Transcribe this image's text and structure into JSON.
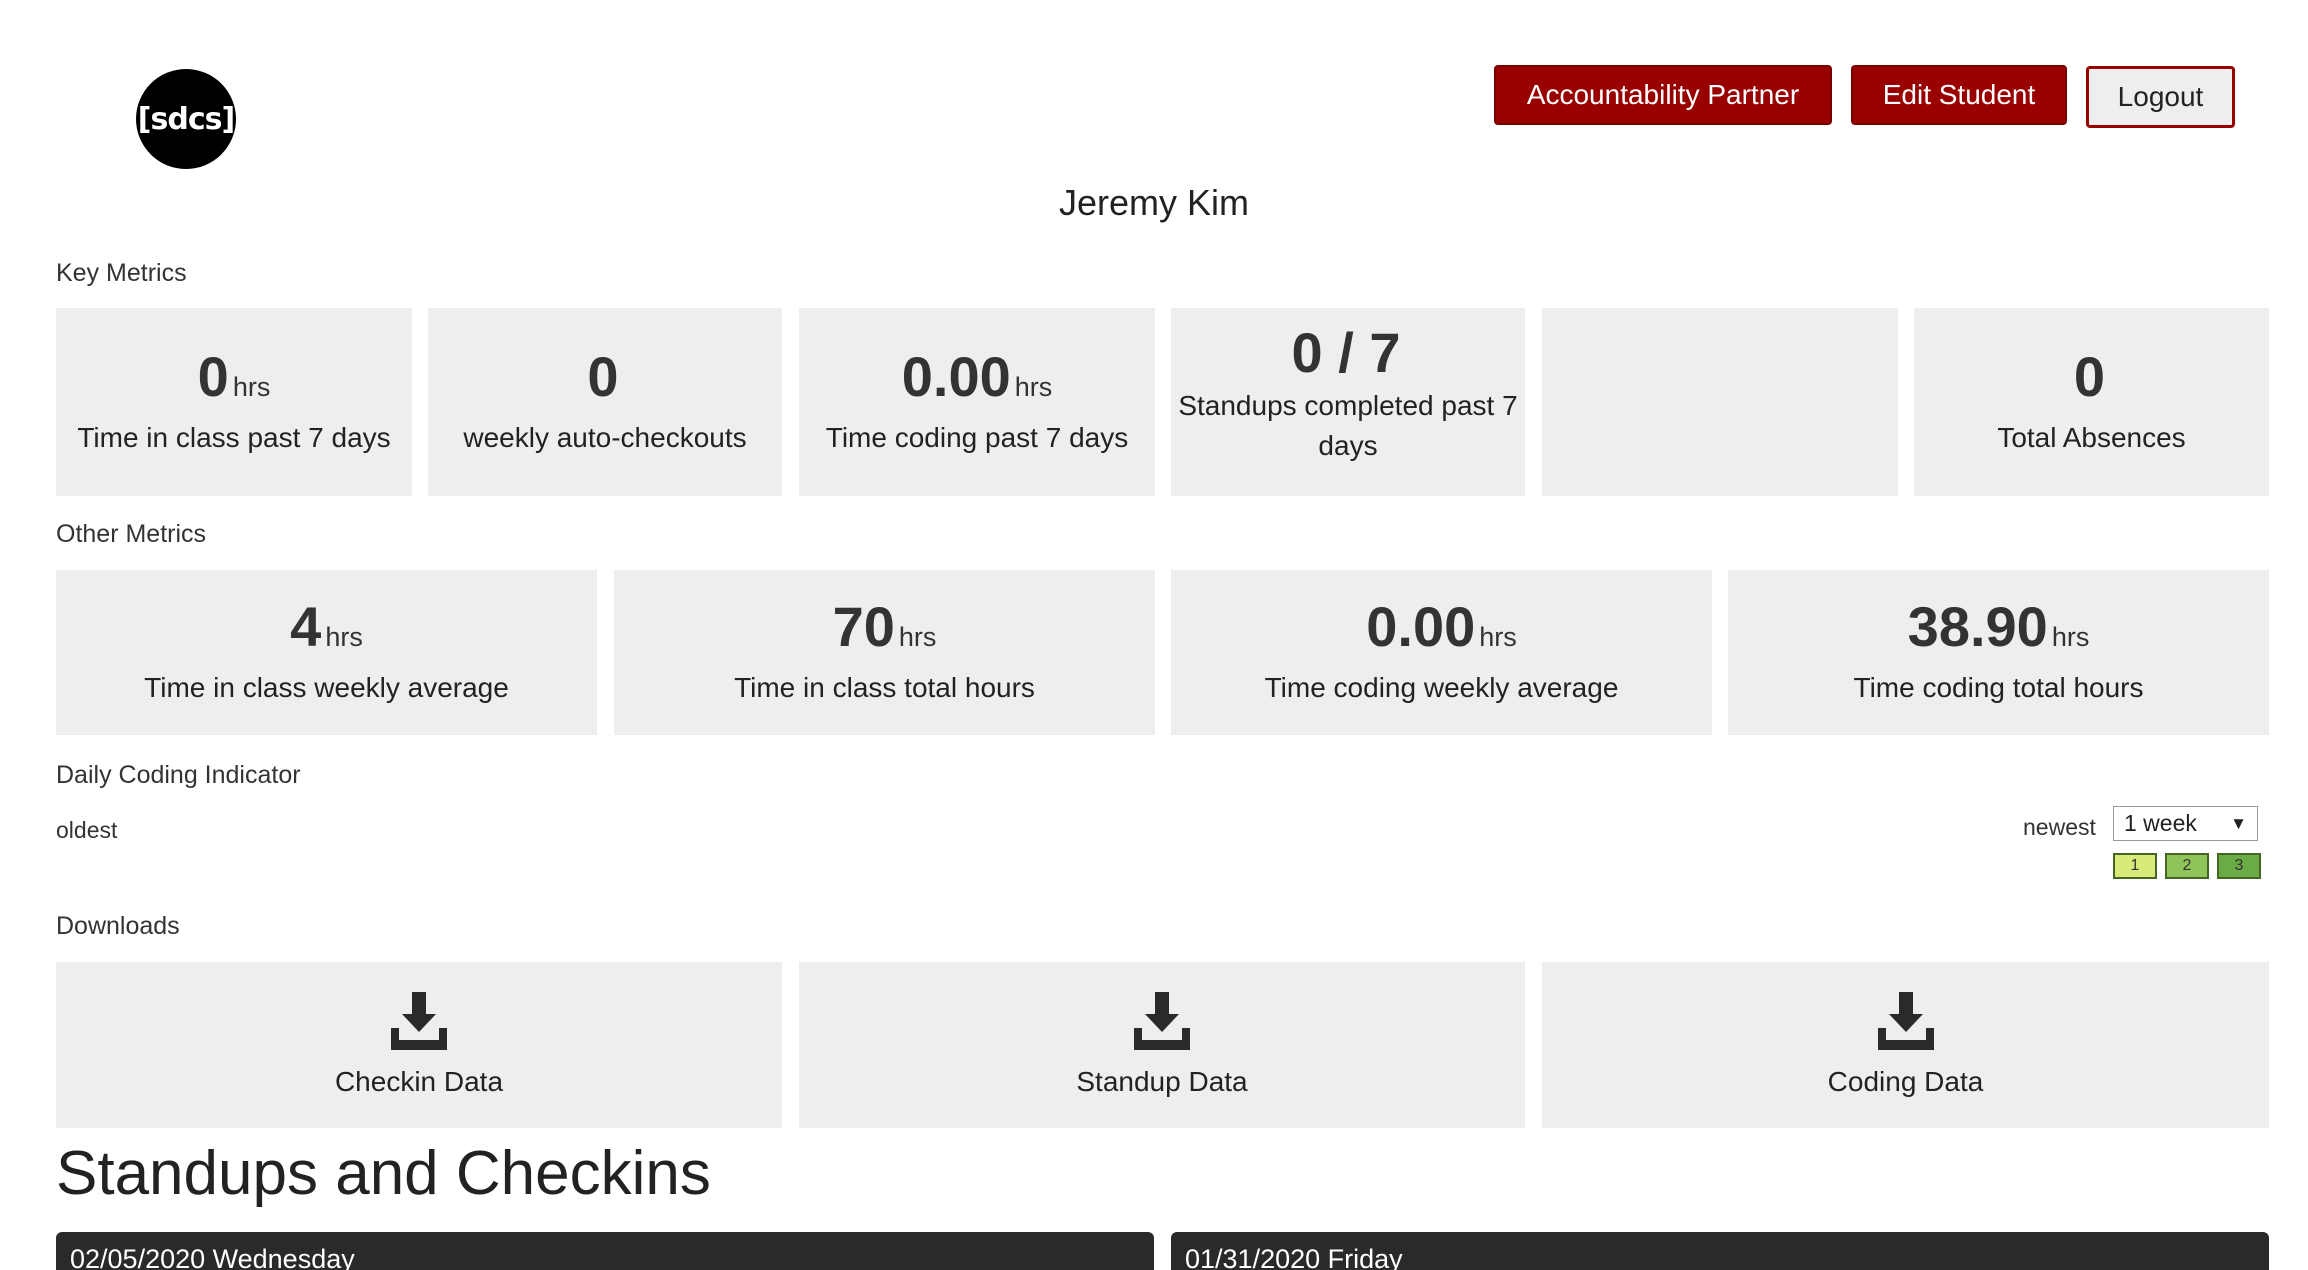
{
  "header": {
    "logo_text": "[sdcs]",
    "buttons": {
      "accountability": "Accountability Partner",
      "edit": "Edit Student",
      "logout": "Logout"
    },
    "colors": {
      "brand_red": "#990000",
      "card_bg": "#eeeeee",
      "dark_bar": "#2a2a2a"
    }
  },
  "student": {
    "name": "Jeremy Kim"
  },
  "key_metrics": {
    "label": "Key Metrics",
    "cards": [
      {
        "value": "0",
        "unit": "hrs",
        "label": "Time in class past 7 days"
      },
      {
        "value": "0",
        "unit": "",
        "label": "weekly auto-checkouts"
      },
      {
        "value": "0.00",
        "unit": "hrs",
        "label": "Time coding past 7 days"
      },
      {
        "value": "0 / 7",
        "unit": "",
        "label": "Standups completed past 7 days"
      },
      {
        "value": "",
        "unit": "",
        "label": ""
      },
      {
        "value": "0",
        "unit": "",
        "label": "Total Absences"
      }
    ]
  },
  "other_metrics": {
    "label": "Other Metrics",
    "cards": [
      {
        "value": "4",
        "unit": "hrs",
        "label": "Time in class weekly average"
      },
      {
        "value": "70",
        "unit": "hrs",
        "label": "Time in class total hours"
      },
      {
        "value": "0.00",
        "unit": "hrs",
        "label": "Time coding weekly average"
      },
      {
        "value": "38.90",
        "unit": "hrs",
        "label": "Time coding total hours"
      }
    ]
  },
  "daily_coding": {
    "label": "Daily Coding Indicator",
    "oldest": "oldest",
    "newest": "newest",
    "range_select": {
      "value": "1 week"
    },
    "legend": [
      {
        "label": "1",
        "color": "#d9ea7a"
      },
      {
        "label": "2",
        "color": "#8fc45a"
      },
      {
        "label": "3",
        "color": "#6aab45"
      }
    ]
  },
  "downloads": {
    "label": "Downloads",
    "items": [
      {
        "label": "Checkin Data",
        "icon": "download-icon"
      },
      {
        "label": "Standup Data",
        "icon": "download-icon"
      },
      {
        "label": "Coding Data",
        "icon": "download-icon"
      }
    ]
  },
  "standups": {
    "heading": "Standups and Checkins",
    "days": [
      {
        "label": "02/05/2020 Wednesday"
      },
      {
        "label": "01/31/2020 Friday"
      }
    ]
  }
}
